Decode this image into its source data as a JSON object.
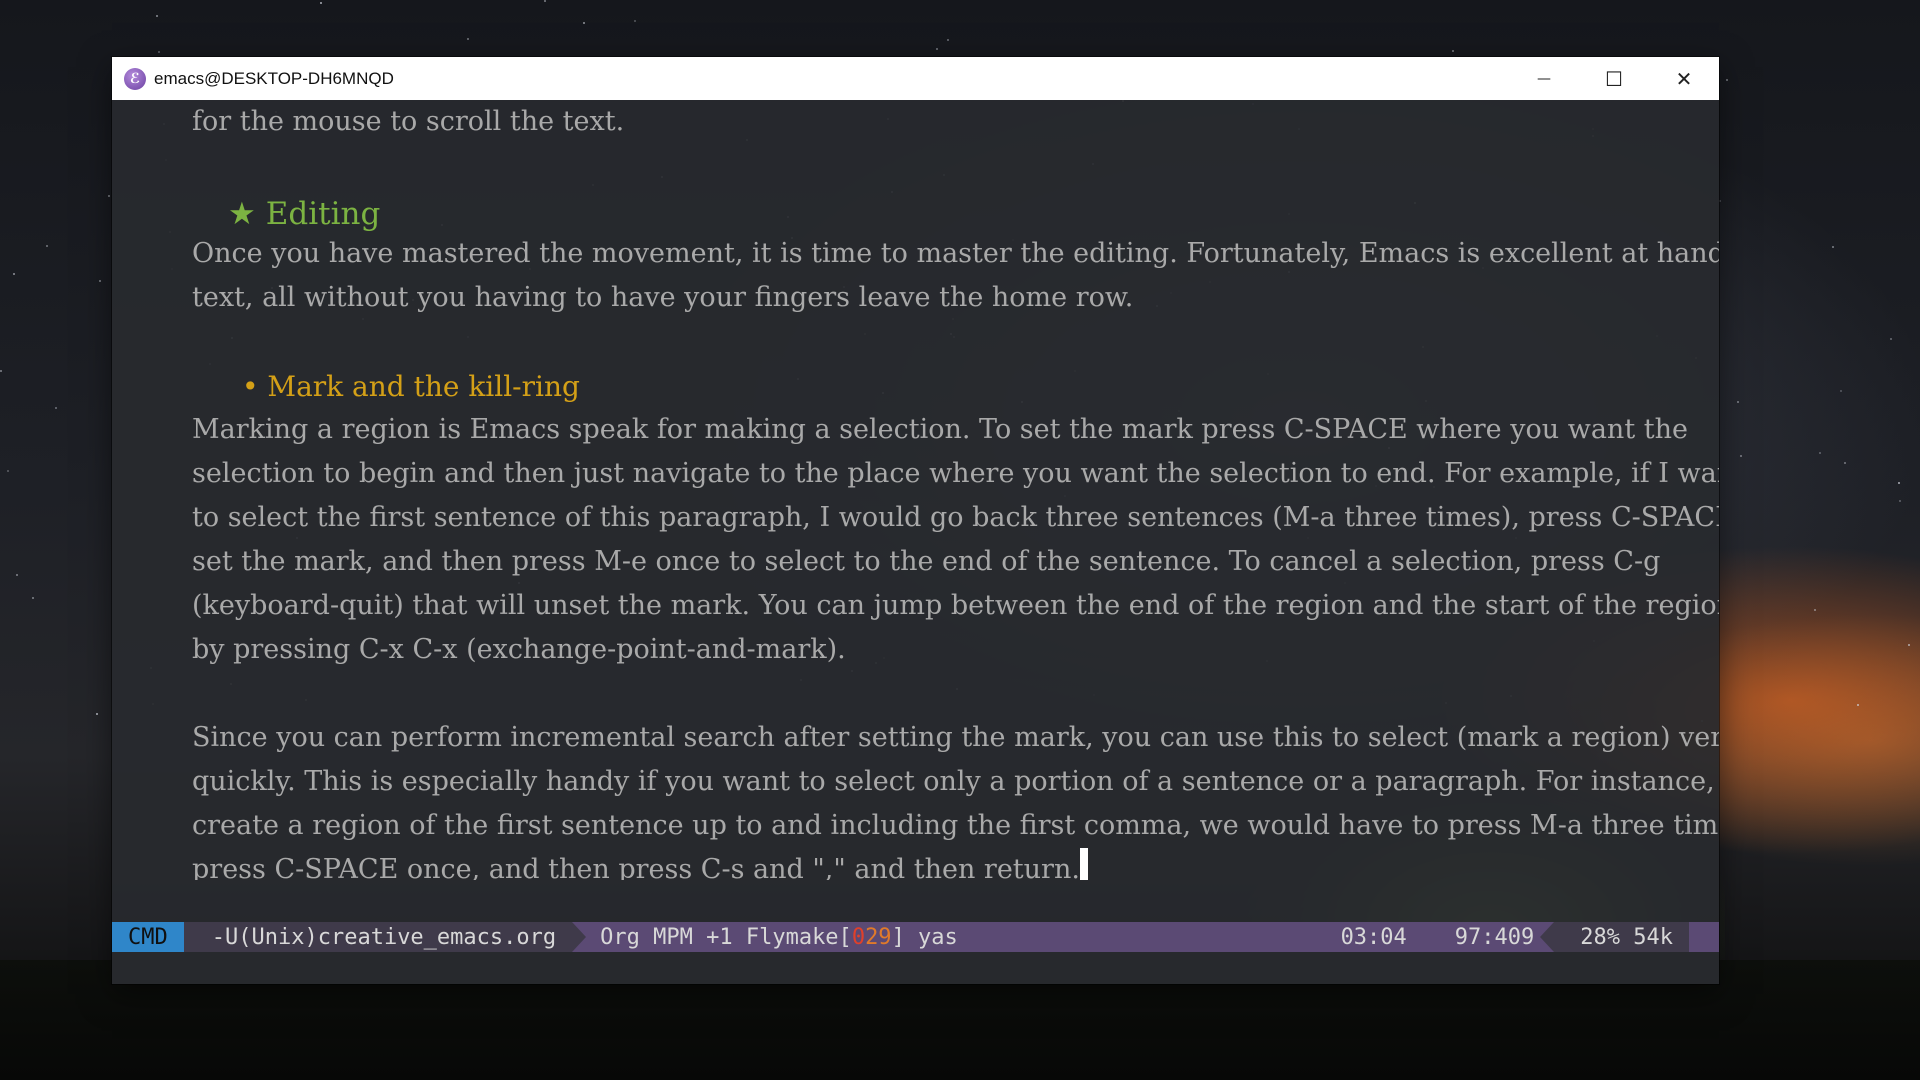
{
  "window": {
    "title": "emacs@DESKTOP-DH6MNQD",
    "app_icon_glyph": "ℰ",
    "controls": {
      "minimize": "—",
      "maximize": "☐",
      "close": "✕"
    }
  },
  "buffer": {
    "top_line": "for the mouse to scroll the text.",
    "heading1": {
      "bullet": "★",
      "text": "Editing"
    },
    "para1": [
      "Once you have mastered the movement, it is time to master the editing. Fortunately, Emacs is excellent at handling",
      "text, all without you having to have your fingers leave the home row."
    ],
    "heading2": {
      "bullet": "•",
      "text": "Mark and the kill-ring"
    },
    "para2": [
      "Marking a region is Emacs speak for making a selection. To set the mark press C-SPACE where you want the",
      "selection to begin and then just navigate to the place where you want the selection to end. For example, if I wanted",
      "to select the first sentence of this paragraph, I would go back three sentences (M-a three times), press C-SPACE to",
      "set the mark, and then press M-e once to select to the end of the sentence. To cancel a selection, press C-g",
      "(keyboard-quit) that will unset the mark. You can jump between the end of the region and the start of the region",
      "by pressing C-x C-x (exchange-point-and-mark)."
    ],
    "para3": [
      "Since you can perform incremental search after setting the mark, you can use this to select (mark a region) very",
      "quickly. This is especially handy if you want to select only a portion of a sentence or a paragraph. For instance, to",
      "create a region of the first sentence up to and including the first comma, we would have to press M-a three times,",
      "press C-SPACE once, and then press C-s and \",\" and then return."
    ]
  },
  "modeline": {
    "state": "CMD",
    "encoding": "-U(Unix)",
    "filename": "creative_emacs.org",
    "modes_prefix": "Org MPM +1 Flymake[",
    "flymake_errors": "0",
    "flymake_warnings": "29",
    "modes_suffix": "] yas",
    "time": "03:04",
    "position": "97:409",
    "percent_size": "28% 54k"
  },
  "colors": {
    "heading1": "#7cb342",
    "heading2": "#d4a017",
    "body_text": "#a9a9a9",
    "state_badge": "#2f86c9",
    "modeline_bg": "#5b4a74"
  }
}
